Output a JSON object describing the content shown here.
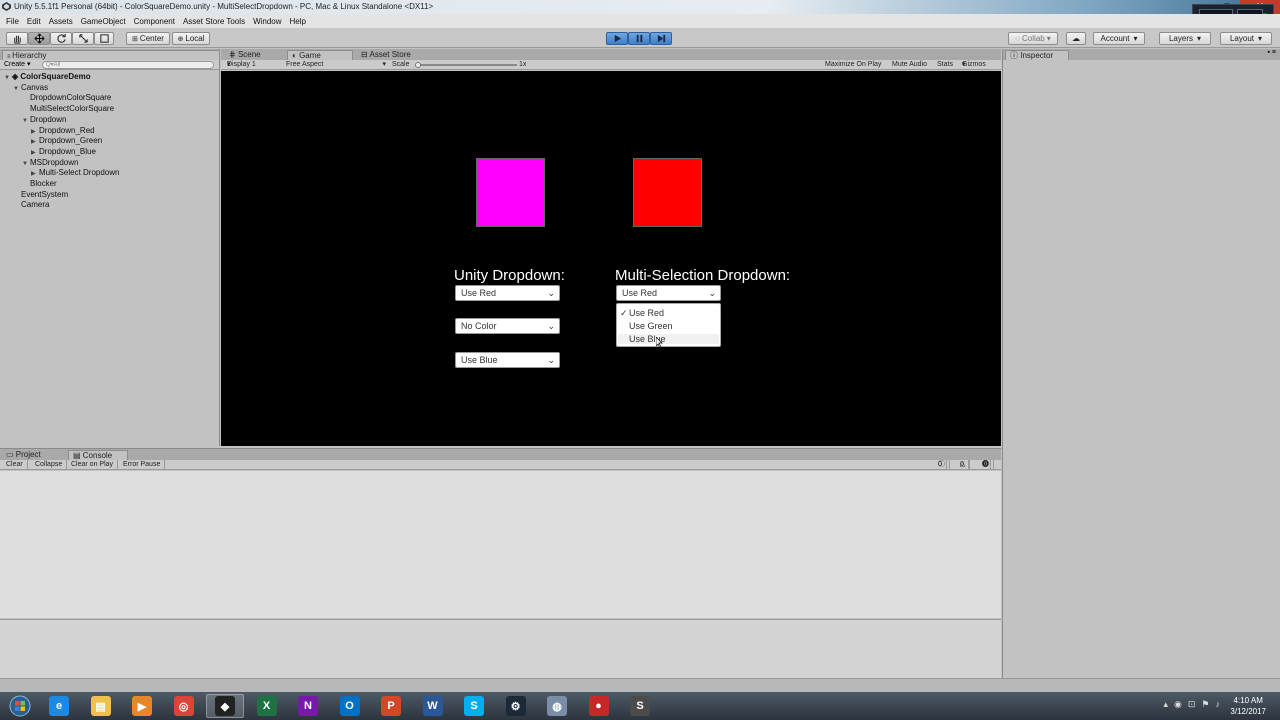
{
  "window": {
    "title": "Unity 5.5.1f1 Personal (64bit) - ColorSquareDemo.unity - MultiSelectDropdown - PC, Mac & Linux Standalone <DX11>"
  },
  "menu": [
    "File",
    "Edit",
    "Assets",
    "GameObject",
    "Component",
    "Asset Store Tools",
    "Window",
    "Help"
  ],
  "toolbar": {
    "center_label": "Center",
    "local_label": "Local",
    "collab_label": "Collab",
    "account_label": "Account",
    "layers_label": "Layers",
    "layout_label": "Layout"
  },
  "hierarchy": {
    "tab": "Hierarchy",
    "create_label": "Create",
    "search_placeholder": "Q▾All",
    "items": [
      {
        "label": "ColorSquareDemo",
        "indent": 0,
        "arrow": "▼"
      },
      {
        "label": "Canvas",
        "indent": 1,
        "arrow": "▼"
      },
      {
        "label": "DropdownColorSquare",
        "indent": 2,
        "arrow": ""
      },
      {
        "label": "MultiSelectColorSquare",
        "indent": 2,
        "arrow": ""
      },
      {
        "label": "Dropdown",
        "indent": 2,
        "arrow": "▼"
      },
      {
        "label": "Dropdown_Red",
        "indent": 3,
        "arrow": "▶"
      },
      {
        "label": "Dropdown_Green",
        "indent": 3,
        "arrow": "▶"
      },
      {
        "label": "Dropdown_Blue",
        "indent": 3,
        "arrow": "▶"
      },
      {
        "label": "MSDropdown",
        "indent": 2,
        "arrow": "▼"
      },
      {
        "label": "Multi-Select Dropdown",
        "indent": 3,
        "arrow": "▶"
      },
      {
        "label": "Blocker",
        "indent": 2,
        "arrow": ""
      },
      {
        "label": "EventSystem",
        "indent": 1,
        "arrow": ""
      },
      {
        "label": "Camera",
        "indent": 1,
        "arrow": ""
      }
    ]
  },
  "tabs": {
    "scene": "Scene",
    "game": "Game",
    "asset_store": "Asset Store",
    "inspector": "Inspector",
    "project": "Project",
    "console": "Console"
  },
  "gamebar": {
    "display": "Display 1",
    "aspect": "Free Aspect",
    "scale_label": "Scale",
    "scale_value": "1x",
    "maximize": "Maximize On Play",
    "mute": "Mute Audio",
    "stats": "Stats",
    "gizmos": "Gizmos"
  },
  "game": {
    "square_left_color": "#ff00ff",
    "square_right_color": "#ff0000",
    "unity_label": "Unity Dropdown:",
    "ms_label": "Multi-Selection Dropdown:",
    "unity_dropdowns": [
      "Use Red",
      "No Color",
      "Use Blue"
    ],
    "ms_selected": "Use Red",
    "ms_options": [
      {
        "label": "Use Red",
        "checked": true
      },
      {
        "label": "Use Green",
        "checked": false
      },
      {
        "label": "Use Blue",
        "checked": false
      }
    ]
  },
  "console": {
    "buttons": [
      "Clear",
      "Collapse",
      "Clear on Play",
      "Error Pause"
    ],
    "counts": [
      "0",
      "0",
      "0"
    ]
  },
  "taskbar": {
    "time": "4:10 AM",
    "date": "3/12/2017",
    "apps": [
      "ie",
      "explorer",
      "media",
      "chrome",
      "unity",
      "excel",
      "onenote",
      "outlook",
      "powerpoint",
      "word",
      "skype",
      "steam",
      "app",
      "record",
      "sublime"
    ]
  }
}
